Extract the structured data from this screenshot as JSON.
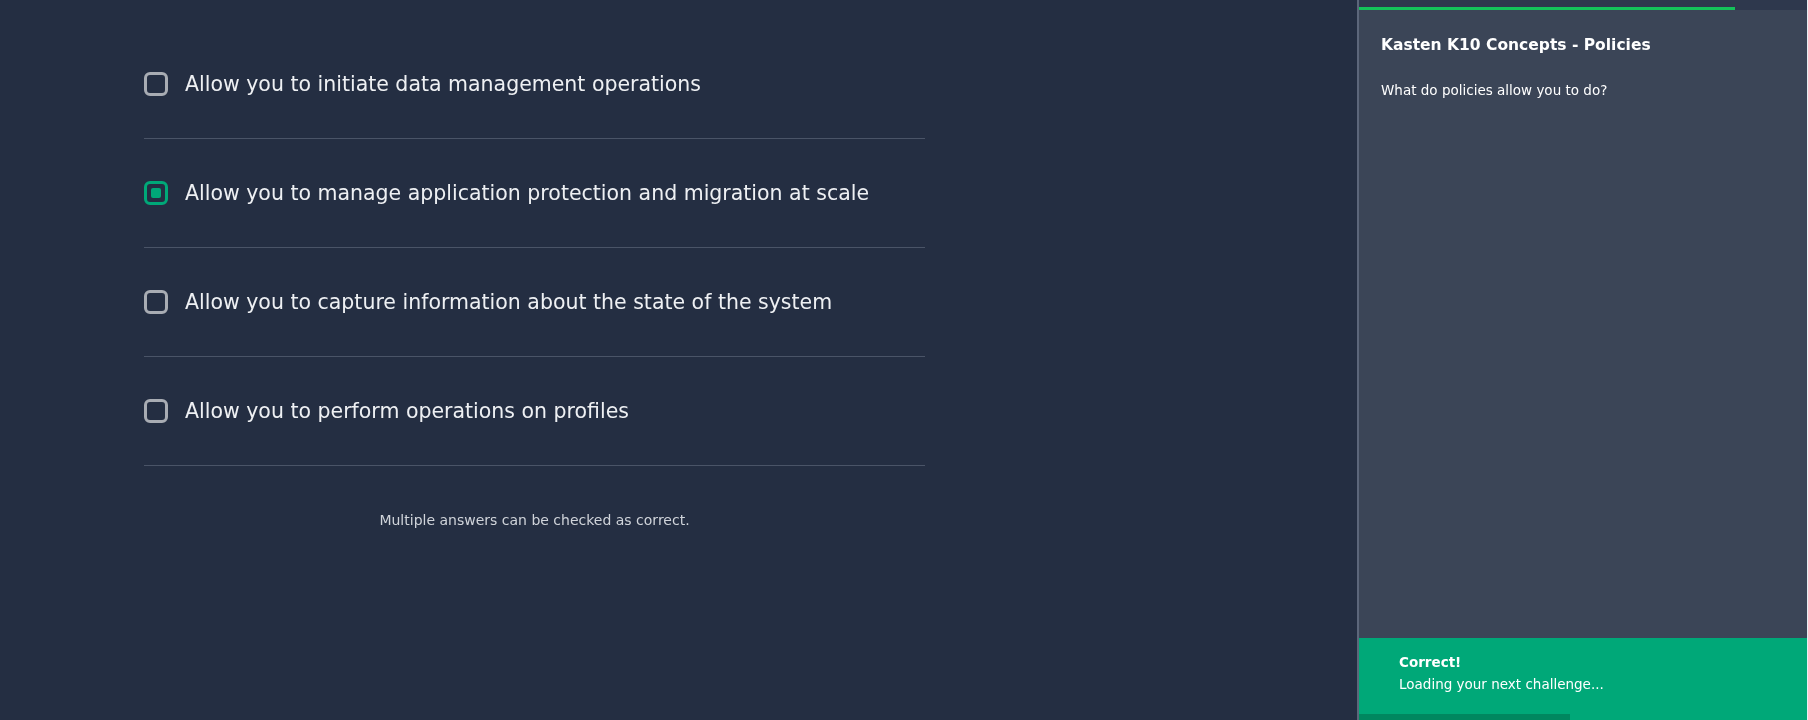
{
  "quiz": {
    "options": [
      {
        "label": "Allow you to initiate data management operations",
        "checked": false
      },
      {
        "label": "Allow you to manage application protection and migration at scale",
        "checked": true
      },
      {
        "label": "Allow you to capture information about the state of the system",
        "checked": false
      },
      {
        "label": "Allow you to perform operations on profiles",
        "checked": false
      }
    ],
    "hint": "Multiple answers can be checked as correct."
  },
  "side_panel": {
    "progress": {
      "level": 0.84
    },
    "title": "Kasten K10 Concepts - Policies",
    "question": "What do policies allow you to do?",
    "feedback": {
      "title": "Correct!",
      "message": "Loading your next challenge...",
      "progress": {
        "level": 0.47
      }
    }
  }
}
